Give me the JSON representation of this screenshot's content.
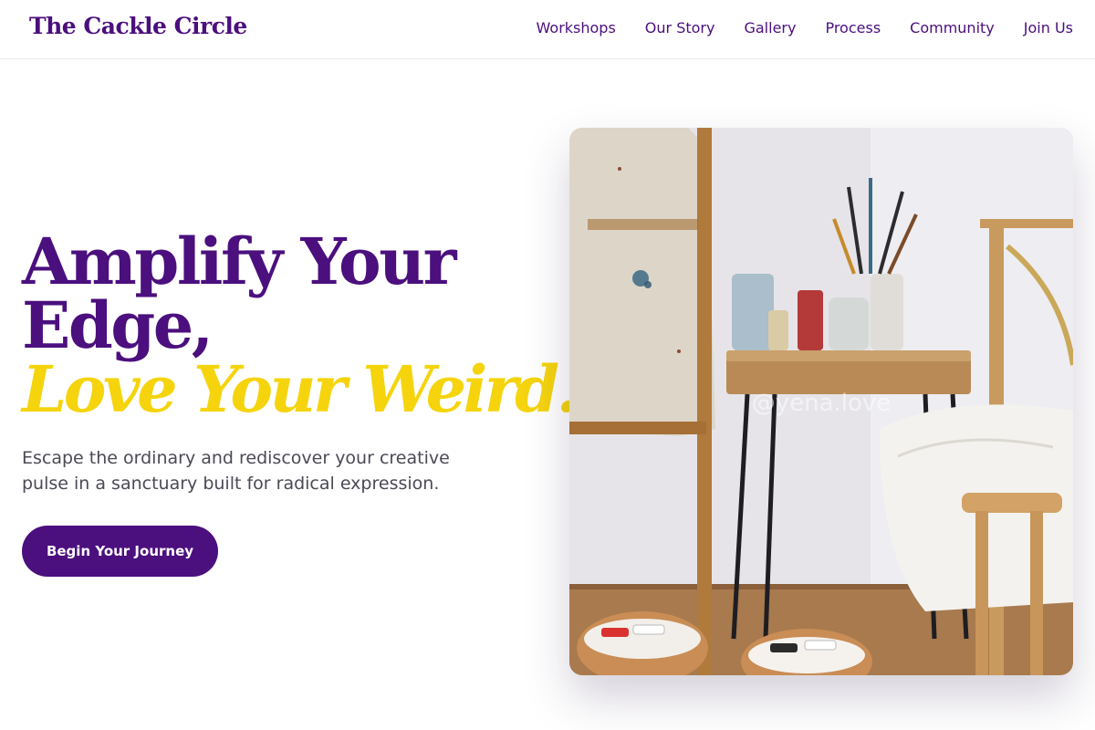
{
  "brand": {
    "name": "The Cackle Circle"
  },
  "nav": {
    "items": [
      {
        "label": "Workshops"
      },
      {
        "label": "Our Story"
      },
      {
        "label": "Gallery"
      },
      {
        "label": "Process"
      },
      {
        "label": "Community"
      },
      {
        "label": "Join Us"
      }
    ]
  },
  "hero": {
    "title_line1": "Amplify Your",
    "title_line2": "Edge,",
    "title_accent": "Love Your Weird.",
    "subtitle": "Escape the ordinary and rediscover your creative pulse in a sanctuary built for radical expression.",
    "cta_label": "Begin Your Journey",
    "image_watermark": "@yena.love"
  },
  "colors": {
    "brand_purple": "#4b0f7e",
    "accent_yellow": "#f5d40d",
    "body_text": "#4a4a55",
    "background": "#ffffff"
  }
}
